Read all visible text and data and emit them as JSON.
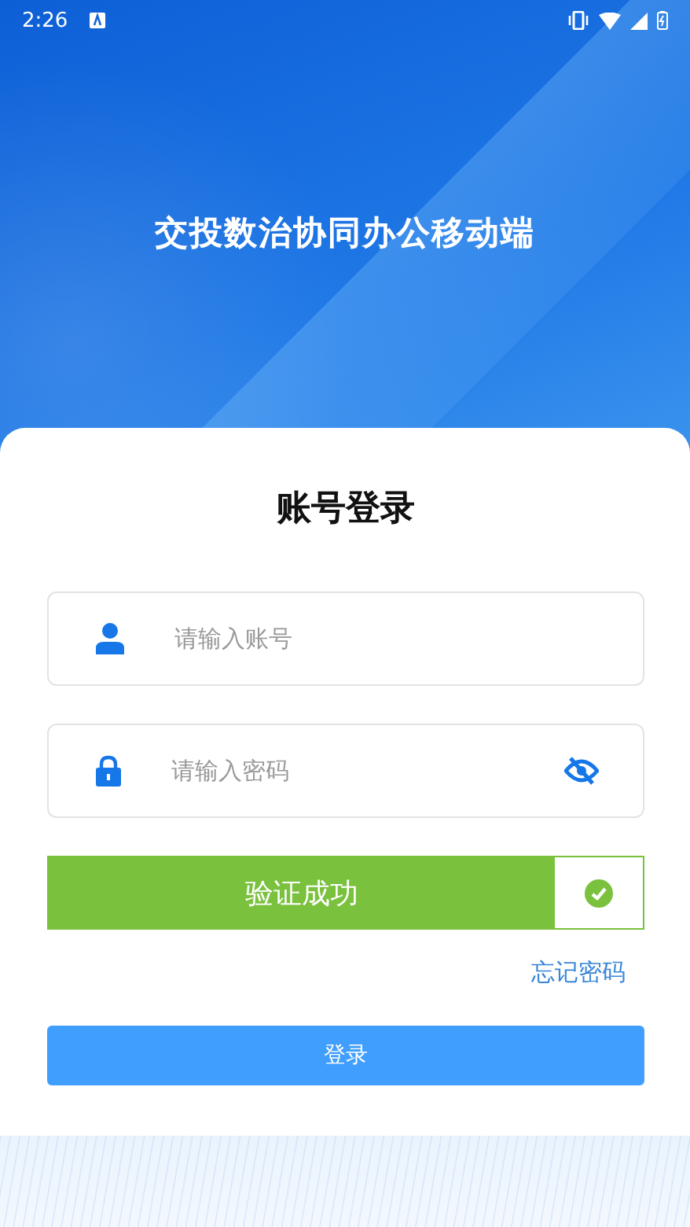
{
  "status_bar": {
    "time": "2:26"
  },
  "app_title": "交投数治协同办公移动端",
  "login": {
    "heading": "账号登录",
    "account_field": {
      "placeholder": "请输入账号"
    },
    "password_field": {
      "placeholder": "请输入密码",
      "visible": false
    },
    "slider_verify": {
      "text": "验证成功",
      "verified": true
    },
    "forgot_link": "忘记密码",
    "login_button": "登录"
  }
}
